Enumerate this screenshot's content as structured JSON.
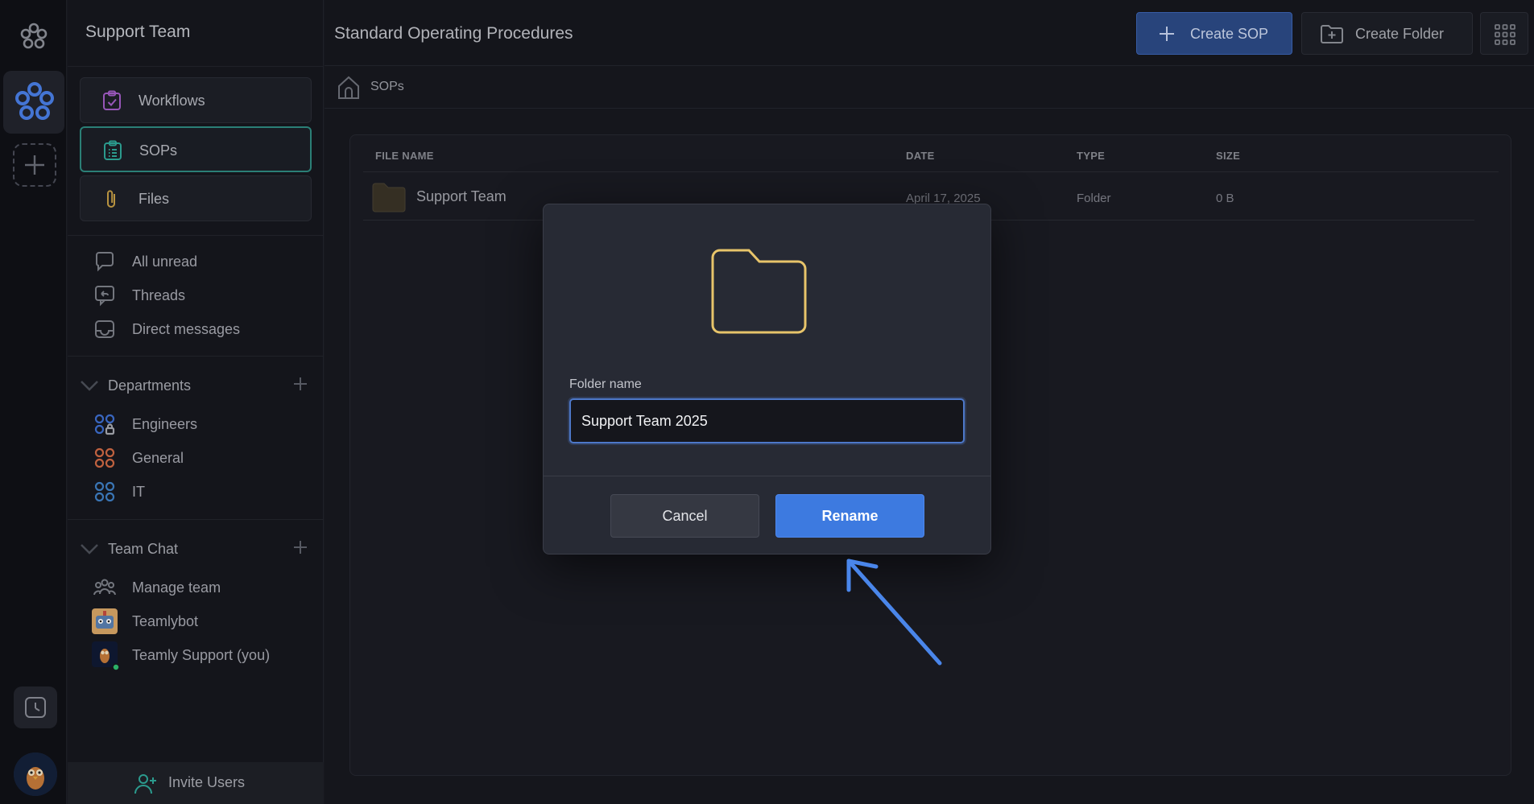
{
  "workspace": {
    "name": "Support Team"
  },
  "nav": [
    {
      "label": "Workflows",
      "icon": "clipboard-check-icon",
      "color": "#a45ec8"
    },
    {
      "label": "SOPs",
      "icon": "list-clipboard-icon",
      "color": "#2fa89a",
      "active": true
    },
    {
      "label": "Files",
      "icon": "paperclip-icon",
      "color": "#c8a046"
    }
  ],
  "quick": [
    {
      "label": "All unread",
      "icon": "chat-bubble-icon"
    },
    {
      "label": "Threads",
      "icon": "threads-icon"
    },
    {
      "label": "Direct messages",
      "icon": "inbox-icon"
    }
  ],
  "departments": {
    "title": "Departments",
    "items": [
      {
        "label": "Engineers",
        "color": "#3e6fd0"
      },
      {
        "label": "General",
        "color": "#d06a45"
      },
      {
        "label": "IT",
        "color": "#3f7fc4"
      }
    ]
  },
  "team_chat": {
    "title": "Team Chat",
    "items": [
      {
        "label": "Manage team",
        "icon": "people-icon"
      },
      {
        "label": "Teamlybot",
        "icon": "bot-avatar"
      },
      {
        "label": "Teamly Support (you)",
        "icon": "user-avatar"
      }
    ]
  },
  "invite": {
    "label": "Invite Users"
  },
  "header": {
    "title": "Standard Operating Procedures",
    "create_sop": "Create SOP",
    "create_folder": "Create Folder"
  },
  "breadcrumb": {
    "label": "SOPs"
  },
  "table": {
    "columns": [
      "FILE NAME",
      "DATE",
      "TYPE",
      "SIZE"
    ],
    "rows": [
      {
        "name": "Support Team",
        "date": "April 17, 2025",
        "type": "Folder",
        "size": "0 B"
      }
    ]
  },
  "modal": {
    "field_label": "Folder name",
    "field_value": "Support Team 2025",
    "cancel": "Cancel",
    "rename": "Rename"
  },
  "colors": {
    "accent": "#3d7ae0",
    "folder_outline": "#e7c46a",
    "annotation_arrow": "#4a86ea"
  }
}
